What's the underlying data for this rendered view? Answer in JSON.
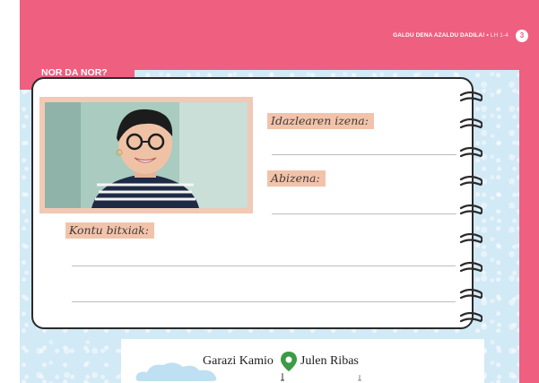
{
  "header": {
    "title": "GALDU DENA AZALDU DADILA!",
    "separator": "•",
    "code": "LH 1-4",
    "page_number": "3"
  },
  "section": {
    "title": "NOR DA NOR?"
  },
  "form": {
    "writer_name_label": "Idazlearen izena:",
    "surname_label": "Abizena:",
    "curious_things_label": "Kontu bitxiak:"
  },
  "footer": {
    "author_1": "Garazi Kamio",
    "author_2": "Julen Ribas",
    "pin_icon": "location-pin-icon"
  },
  "colors": {
    "brand_pink": "#ee5f80",
    "label_highlight": "#f2c3ab",
    "background_blue": "#d2e9f6",
    "pin_green": "#3c9b45"
  }
}
